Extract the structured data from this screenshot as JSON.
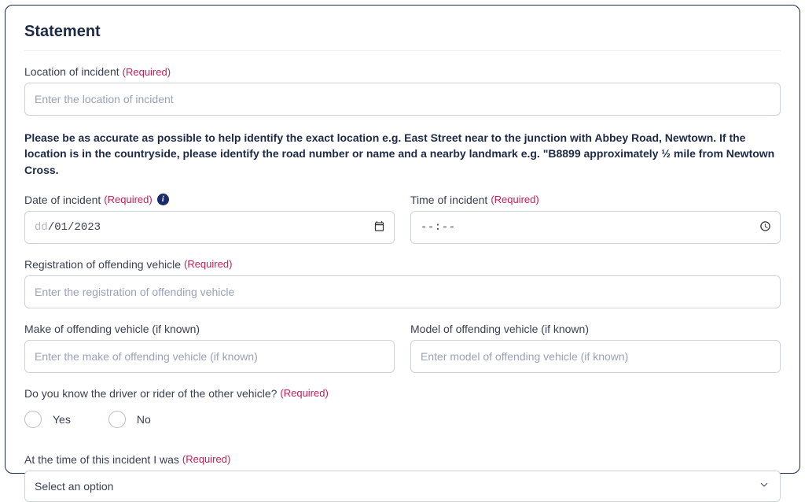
{
  "form": {
    "title": "Statement",
    "required_suffix": "(Required)",
    "location": {
      "label": "Location of incident",
      "placeholder": "Enter the location of incident",
      "helper": "Please be as accurate as possible to help identify the exact location e.g. East Street near to the junction with Abbey Road, Newtown. If the location is in the countryside, please identify the road number or name and a nearby landmark e.g. \"B8899 approximately ½ mile from Newtown Cross."
    },
    "date": {
      "label": "Date of incident",
      "value_dd": "dd",
      "value_mm": "01",
      "value_yyyy": "2023"
    },
    "time": {
      "label": "Time of incident",
      "value": "--:--"
    },
    "reg": {
      "label": "Registration of offending vehicle",
      "placeholder": "Enter the registration of offending vehicle"
    },
    "make": {
      "label": "Make of offending vehicle (if known)",
      "placeholder": "Enter the make of offending vehicle (if known)"
    },
    "model": {
      "label": "Model of offending vehicle (if known)",
      "placeholder": "Enter model of offending vehicle (if known)"
    },
    "know_driver": {
      "label": "Do you know the driver or rider of the other vehicle?",
      "yes": "Yes",
      "no": "No"
    },
    "at_time": {
      "label": "At the time of this incident I was",
      "selected": "Select an option"
    }
  }
}
